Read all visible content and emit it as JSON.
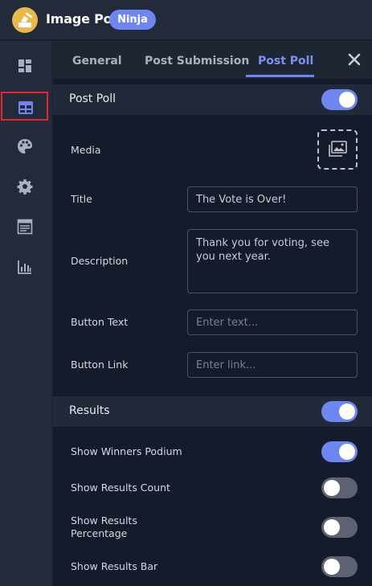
{
  "app": {
    "title": "Image Poll",
    "badge": "Ninja"
  },
  "sidebar": {
    "items": [
      {
        "name": "dashboard-icon"
      },
      {
        "name": "layout-icon",
        "active": true
      },
      {
        "name": "palette-icon"
      },
      {
        "name": "gear-icon"
      },
      {
        "name": "list-icon"
      },
      {
        "name": "chart-icon"
      }
    ]
  },
  "tabs": [
    {
      "label": "General"
    },
    {
      "label": "Post Submission"
    },
    {
      "label": "Post Poll",
      "active": true
    }
  ],
  "post_poll": {
    "title": "Post Poll",
    "enabled": true,
    "media_label": "Media",
    "title_label": "Title",
    "title_value": "The Vote is Over!",
    "description_label": "Description",
    "description_value": "Thank you for voting, see you next year.",
    "button_text_label": "Button Text",
    "button_text_placeholder": "Enter text...",
    "button_link_label": "Button Link",
    "button_link_placeholder": "Enter link..."
  },
  "results": {
    "title": "Results",
    "enabled": true,
    "options": [
      {
        "label": "Show Winners Podium",
        "enabled": true
      },
      {
        "label": "Show Results Count",
        "enabled": false
      },
      {
        "label": "Show Results Percentage",
        "enabled": false
      },
      {
        "label": "Show Results Bar",
        "enabled": false
      }
    ]
  },
  "colors": {
    "accent": "#6e86f0",
    "badge": "#6e86f0",
    "logo": "#e8b84a",
    "highlight": "#e0282e"
  }
}
